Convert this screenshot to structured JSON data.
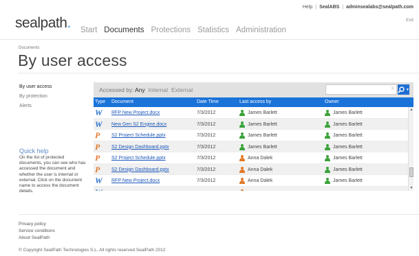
{
  "header": {
    "logo_text": "sealpath",
    "logo_dot": ".",
    "nav": [
      "Start",
      "Documents",
      "Protections",
      "Statistics",
      "Administration"
    ],
    "active_nav": "Documents",
    "help": "Help",
    "org": "SealABS",
    "email": "adminsealabs@sealpath.com",
    "exit": "Exit"
  },
  "page": {
    "breadcrumb": "Documents",
    "title": "By user access"
  },
  "sidebar": {
    "items": [
      "By user access",
      "By protection",
      "Alerts"
    ],
    "active": "By user access"
  },
  "quickhelp": {
    "title": "Quick help",
    "text": "On the list of protected documents, you can see who has accessed the document and whether the user is internal or external. Click on the document name to access the document details."
  },
  "filter": {
    "label": "Accessed by:",
    "options": [
      "Any",
      "Internal",
      "External"
    ],
    "active": "Any",
    "search_value": "",
    "clear_glyph": "X"
  },
  "table": {
    "headers": [
      "Type",
      "Document",
      "Date Time",
      "Last access by",
      "Owner"
    ],
    "rows": [
      {
        "type": "W",
        "document": "RFP New Project.docx",
        "date": "7/3/2012",
        "access": "James Barlett",
        "access_color": "green",
        "owner": "James Barlett"
      },
      {
        "type": "W",
        "document": "New Gen S2 Engine.docx",
        "date": "7/3/2012",
        "access": "James Barlett",
        "access_color": "green",
        "owner": "James Barlett"
      },
      {
        "type": "P",
        "document": "S2 Project Schedule.pptx",
        "date": "7/3/2012",
        "access": "James Barlett",
        "access_color": "green",
        "owner": "James Barlett"
      },
      {
        "type": "P",
        "document": "S2 Design Dashboard.pptx",
        "date": "7/3/2012",
        "access": "James Barlett",
        "access_color": "green",
        "owner": "James Barlett"
      },
      {
        "type": "P",
        "document": "S2 Project Schedule.pptx",
        "date": "7/3/2012",
        "access": "Anna Dalek",
        "access_color": "orange",
        "owner": "James Barlett"
      },
      {
        "type": "P",
        "document": "S2 Design Dashboard.pptx",
        "date": "7/3/2012",
        "access": "Anna Dalek",
        "access_color": "orange",
        "owner": "James Barlett"
      },
      {
        "type": "W",
        "document": "RFP New Project.docx",
        "date": "7/3/2012",
        "access": "Anna Dalek",
        "access_color": "orange",
        "owner": "James Barlett"
      },
      {
        "type": "W",
        "document": "",
        "date": "",
        "access": "",
        "access_color": "orange",
        "owner": ""
      }
    ]
  },
  "footer": {
    "links": [
      "Privacy policy",
      "Service conditions",
      "About SealPath"
    ],
    "copyright": "© Copyright SealPath Technologies S.L. All rights reserved SealPath 2012"
  },
  "colors": {
    "accent_blue": "#1a73d9",
    "word_icon": "#2a72c9",
    "ppt_icon": "#e07a30",
    "internal_user": "#3aa33a",
    "external_user": "#e27a2a"
  }
}
